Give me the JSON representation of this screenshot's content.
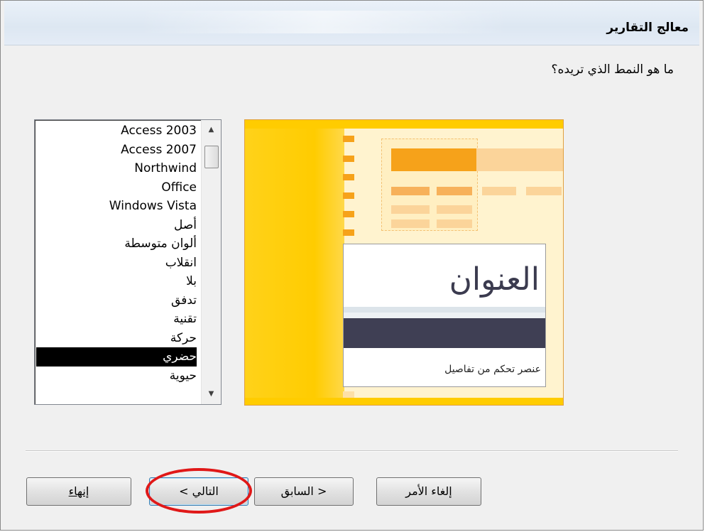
{
  "window": {
    "title": "معالج التقارير"
  },
  "question": "ما هو النمط الذي تريده؟",
  "styles": {
    "items": [
      "Access 2003",
      "Access 2007",
      "Northwind",
      "Office",
      "Windows Vista",
      "أصل",
      "ألوان متوسطة",
      "انقلاب",
      "بلا",
      "تدفق",
      "تقنية",
      "حركة",
      "حضري",
      "حيوية"
    ],
    "selected": "حضري"
  },
  "preview": {
    "title": "العنوان",
    "detail": "عنصر تحكم من تفاصيل"
  },
  "buttons": {
    "cancel": "إلغاء الأمر",
    "back": "< السابق",
    "next": "التالي >",
    "finish": "إنهاء"
  },
  "colors": {
    "accent_yellow": "#ffcc00",
    "accent_orange": "#f6a21a",
    "highlight_red": "#e01818"
  }
}
